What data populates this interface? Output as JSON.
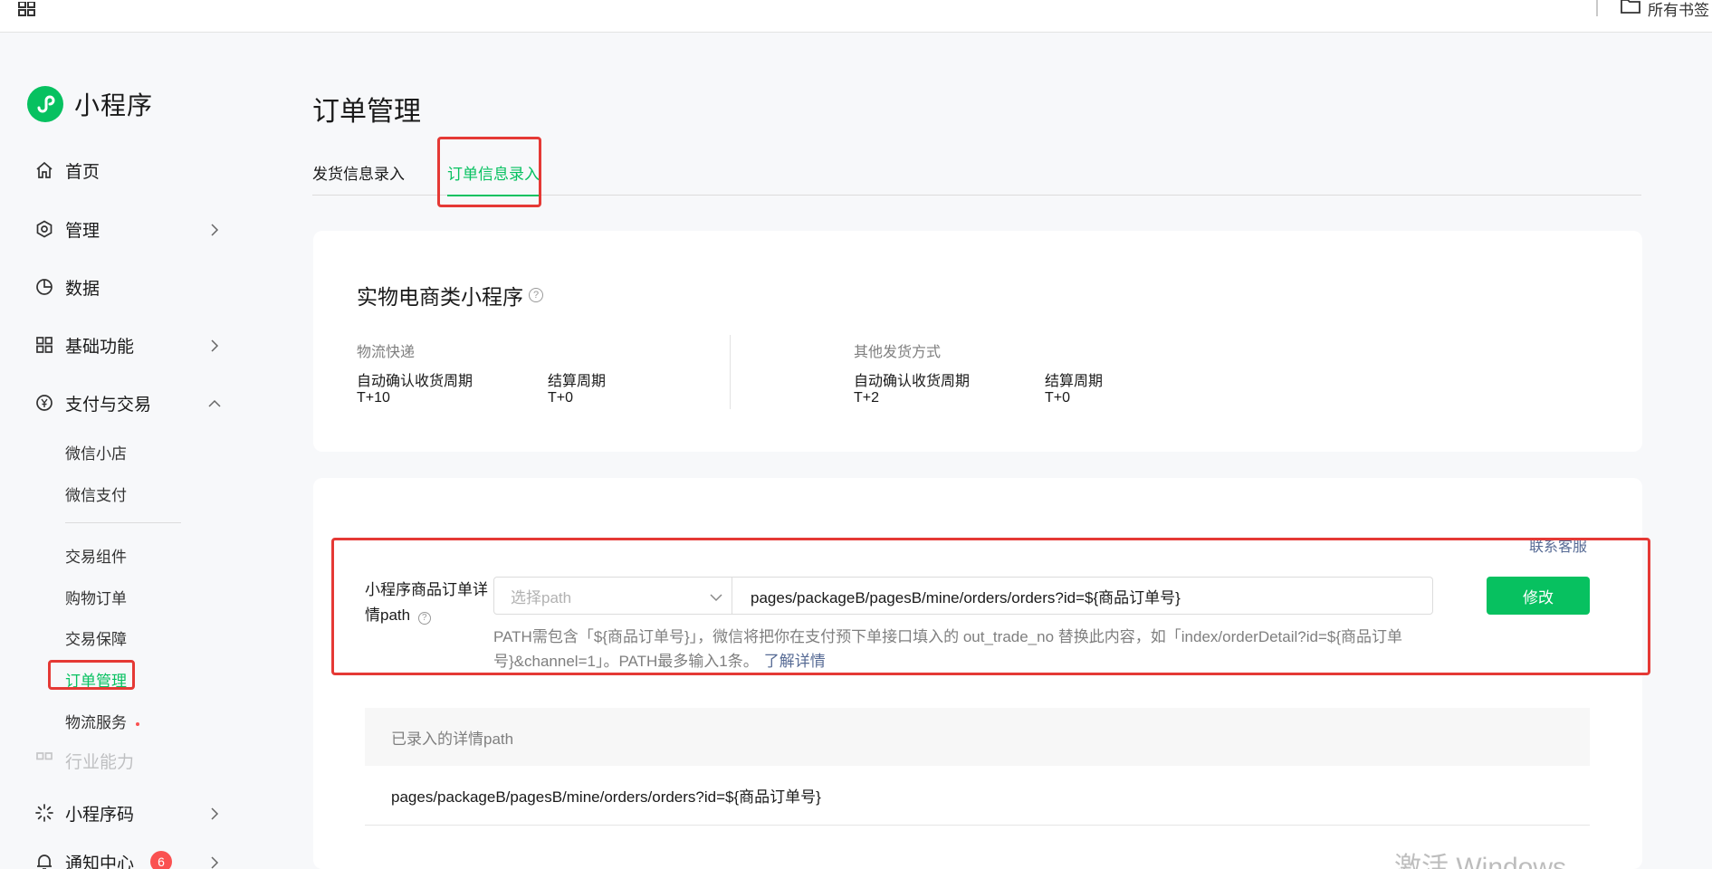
{
  "topbar": {
    "apps_icon": "grid-apps-icon",
    "bookmark_icon": "folder-icon",
    "bookmark_label": "所有书签"
  },
  "brand": {
    "name": "小程序",
    "logo_icon": "mini-program-logo",
    "color": "#07c160"
  },
  "sidebar": {
    "items": [
      {
        "label": "首页",
        "icon": "home-icon"
      },
      {
        "label": "管理",
        "icon": "settings-icon"
      },
      {
        "label": "数据",
        "icon": "pie-chart-icon"
      },
      {
        "label": "基础功能",
        "icon": "grid-icon"
      },
      {
        "label": "支付与交易",
        "icon": "yen-icon"
      }
    ],
    "pay_subitems": [
      "微信小店",
      "微信支付",
      "交易组件",
      "购物订单",
      "交易保障",
      "订单管理",
      "物流服务"
    ],
    "faded_item": "行业能力",
    "bottom_items": [
      {
        "label": "小程序码",
        "icon": "qr-icon"
      },
      {
        "label": "通知中心",
        "icon": "bell-icon",
        "badge": "6"
      }
    ]
  },
  "main": {
    "title": "订单管理",
    "tabs": [
      {
        "label": "发货信息录入",
        "active": false
      },
      {
        "label": "订单信息录入",
        "active": true
      }
    ],
    "card1": {
      "title": "实物电商类小程序",
      "express": {
        "section": "物流快递",
        "confirm_label": "自动确认收货周期",
        "confirm_value": "T+10",
        "settle_label": "结算周期",
        "settle_value": "T+0"
      },
      "other": {
        "section": "其他发货方式",
        "confirm_label": "自动确认收货周期",
        "confirm_value": "T+2",
        "settle_label": "结算周期",
        "settle_value": "T+0"
      }
    },
    "card2": {
      "contact": "联系客服",
      "path_label": "小程序商品订单详情path",
      "select_placeholder": "选择path",
      "path_value": "pages/packageB/pagesB/mine/orders/orders?id=${商品订单号}",
      "modify_button": "修改",
      "hint": "PATH需包含「${商品订单号}」，微信将把你在支付预下单接口填入的 out_trade_no 替换此内容，如「index/orderDetail?id=${商品订单号}&channel=1」。PATH最多输入1条。",
      "hint_link": "了解详情",
      "table_header": "已录入的详情path",
      "table_rows": [
        "pages/packageB/pagesB/mine/orders/orders?id=${商品订单号}"
      ]
    }
  },
  "watermark": "激活 Windows",
  "colors": {
    "accent": "#07c160",
    "link": "#576b95",
    "annotation": "#e53935",
    "badge": "#fa5151"
  }
}
